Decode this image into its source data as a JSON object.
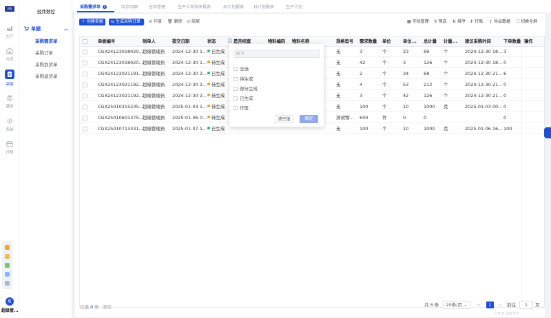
{
  "app": {
    "logo_text": "JWJ",
    "brand": "经纬数控"
  },
  "rail": [
    {
      "label": "生产",
      "icon": "factory-icon"
    },
    {
      "label": "仓库",
      "icon": "warehouse-icon"
    },
    {
      "label": "采购",
      "icon": "purchase-icon",
      "active": true
    },
    {
      "label": "基础",
      "icon": "layers-icon"
    },
    {
      "label": "系统",
      "icon": "gear-icon"
    },
    {
      "label": "日程",
      "icon": "calendar-icon"
    }
  ],
  "user": {
    "avatar": "超",
    "name": "超级管..."
  },
  "menu": {
    "group": "单据",
    "items": [
      {
        "label": "采购需求单",
        "active": true
      },
      {
        "label": "采购订单"
      },
      {
        "label": "采购到货单"
      },
      {
        "label": "采购退货单"
      }
    ]
  },
  "tabs": [
    {
      "label": "采购需求单",
      "active": true
    },
    {
      "label": "库存明细"
    },
    {
      "label": "仓库管理"
    },
    {
      "label": "生产工单效率报表"
    },
    {
      "label": "周计划报表"
    },
    {
      "label": "日计划报表"
    },
    {
      "label": "生产计划"
    }
  ],
  "toolbar": {
    "create": "创建单据",
    "generate_po": "生成采购订单",
    "void": "作废",
    "delete": "删除",
    "close": "结案",
    "right": [
      "字段管理",
      "筛选",
      "排序",
      "行高",
      "导出数据",
      "切换全屏"
    ]
  },
  "table": {
    "headers": [
      "单据编号",
      "制单人",
      "提交日期",
      "状态",
      "是否结案",
      "物料编码",
      "物料名称",
      "规格型号",
      "需求数量",
      "单位",
      "单位...",
      "总计量",
      "计量...",
      "建议采购时间",
      "下单数量",
      "操作"
    ],
    "rows": [
      [
        "CGX24123018020...",
        "超级管理员",
        "2024-12-30 1...",
        "已生成",
        "",
        "",
        "",
        "无",
        "3",
        "个",
        "23",
        "69",
        "个",
        "2024-12-30 18...",
        "3"
      ],
      [
        "CGX24123018020...",
        "超级管理员",
        "2024-12-30 1...",
        "待生成",
        "",
        "",
        "",
        "无",
        "42",
        "个",
        "3",
        "126",
        "个",
        "2024-12-30 18...",
        "0"
      ],
      [
        "CGX24123021191...",
        "超级管理员",
        "2024-12-30 2...",
        "已生成",
        "",
        "",
        "",
        "无",
        "2",
        "个",
        "34",
        "68",
        "个",
        "2024-12-30 21...",
        "6"
      ],
      [
        "CGX24123021192...",
        "超级管理员",
        "2024-12-30 2...",
        "待生成",
        "",
        "",
        "",
        "无",
        "4",
        "个",
        "53",
        "212",
        "个",
        "2024-12-30 21...",
        "0"
      ],
      [
        "CGX24123021192...",
        "超级管理员",
        "2024-12-30 2...",
        "待生成",
        "",
        "",
        "",
        "无",
        "3",
        "个",
        "42",
        "126",
        "个",
        "2024-12-30 21...",
        "0"
      ],
      [
        "CGX25010315235...",
        "超级管理员",
        "2025-01-03 1...",
        "待生成",
        "",
        "",
        "",
        "无",
        "100",
        "个",
        "10",
        "1000",
        "克",
        "2025-01-03 00...",
        "0"
      ],
      [
        "CGX25010601375...",
        "超级管理员",
        "2025-01-06 0...",
        "待生成",
        "",
        "",
        "",
        "测试物...",
        "600",
        "件",
        "0",
        "0",
        "",
        "",
        "0"
      ],
      [
        "CGX25010713331...",
        "超级管理员",
        "2025-01-07 1...",
        "已生成",
        "",
        "",
        "",
        "无",
        "100",
        "个",
        "10",
        "1000",
        "克",
        "2025-01-06 16...",
        "100"
      ]
    ],
    "status_colors": {
      "已生成": "#2bb673",
      "待生成": "#f0a020"
    }
  },
  "filter_popup": {
    "search_placeholder": "Q",
    "options": [
      "全选",
      "待生成",
      "部分生成",
      "已生成",
      "作废"
    ],
    "clear": "清空值",
    "confirm": "确定"
  },
  "footer": {
    "selected_prefix": "已选",
    "selected_count": "0",
    "selected_suffix": "条",
    "clear": "清空",
    "total": "共 8 条",
    "page_size": "20条/页",
    "prev": "<",
    "current_page": "1",
    "next": ">",
    "goto_label": "前往",
    "goto_value": "1",
    "page_suffix": "页"
  },
  "watermark": "CSDN @赵世杰",
  "colors": {
    "accent": "#1d4fd7"
  }
}
